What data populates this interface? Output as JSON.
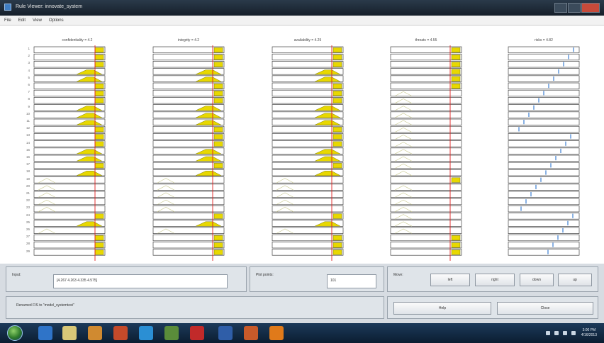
{
  "window": {
    "title": "Rule Viewer: innovate_system"
  },
  "menu": [
    "File",
    "Edit",
    "View",
    "Options"
  ],
  "variables": [
    {
      "key": "v1",
      "label": "confidentiality = 4.2",
      "input_value": 4.2
    },
    {
      "key": "v2",
      "label": "integrity = 4.2",
      "input_value": 4.2
    },
    {
      "key": "v3",
      "label": "availability = 4.25",
      "input_value": 4.25
    },
    {
      "key": "v4",
      "label": "threats = 4.55",
      "input_value": 4.55
    }
  ],
  "output": {
    "label": "risks = 4.82"
  },
  "rule_numbers": [
    "1",
    "2",
    "3",
    "4",
    "5",
    "6",
    "7",
    "8",
    "9",
    "10",
    "11",
    "12",
    "13",
    "14",
    "15",
    "16",
    "17",
    "18",
    "19",
    "20",
    "21",
    "22",
    "23",
    "24",
    "25",
    "26",
    "27",
    "28",
    "29"
  ],
  "input": {
    "label": "Input:",
    "value": "[4.267 4.263 4.335 4.575]"
  },
  "plot_points": {
    "label": "Plot points:",
    "value": "101"
  },
  "move": {
    "label": "Move:",
    "buttons": [
      "left",
      "right",
      "down",
      "up"
    ]
  },
  "status": {
    "text": "Renamed FIS to \"model_systemtest\""
  },
  "actions": {
    "help": "Help",
    "close": "Close"
  },
  "taskbar": {
    "time": "3:00 PM",
    "date": "4/16/2013"
  },
  "colors": {
    "mf_fill": "#e8d800",
    "mf_line": "#7a7a00",
    "red_line": "#e02020",
    "output_line": "#3b7fd1",
    "faint_curve": "#c9c990"
  }
}
